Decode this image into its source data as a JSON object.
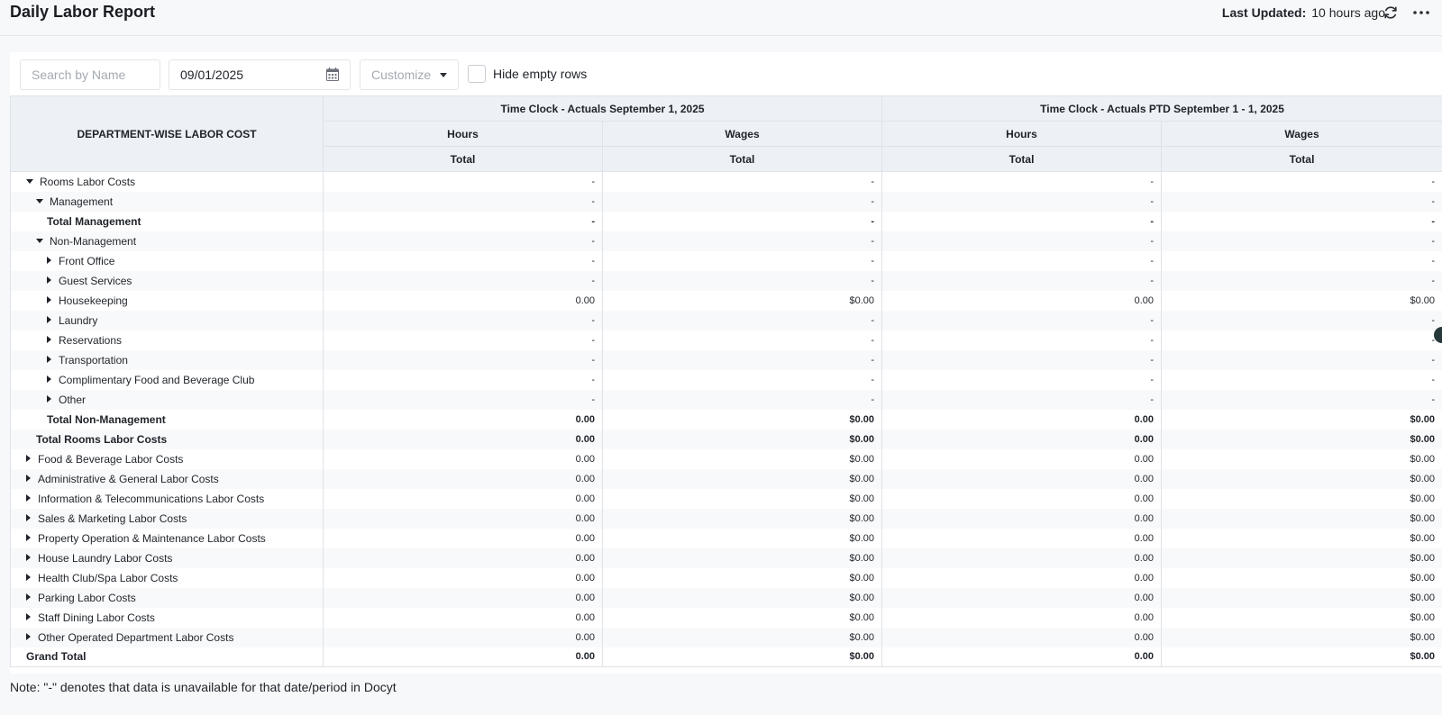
{
  "header": {
    "title": "Daily Labor Report",
    "last_updated_label": "Last Updated:",
    "last_updated_value": "10 hours ago"
  },
  "toolbar": {
    "search_placeholder": "Search by Name",
    "date_value": "09/01/2025",
    "customize_label": "Customize",
    "hide_empty_label": "Hide empty rows",
    "hide_empty_checked": false
  },
  "table": {
    "corner_header": "DEPARTMENT-WISE LABOR COST",
    "group_headers": [
      "Time Clock - Actuals September 1, 2025",
      "Time Clock - Actuals PTD September 1 - 1, 2025"
    ],
    "sub_headers": [
      "Hours",
      "Wages",
      "Hours",
      "Wages"
    ],
    "total_headers": [
      "Total",
      "Total",
      "Total",
      "Total"
    ],
    "rows": [
      {
        "label": "Rooms Labor Costs",
        "indent": 1,
        "toggle": "expanded",
        "bold": false,
        "values": [
          "-",
          "-",
          "-",
          "-"
        ]
      },
      {
        "label": "Management",
        "indent": 2,
        "toggle": "expanded",
        "bold": false,
        "values": [
          "-",
          "-",
          "-",
          "-"
        ]
      },
      {
        "label": "Total Management",
        "indent": 3,
        "toggle": "none",
        "bold": true,
        "values": [
          "-",
          "-",
          "-",
          "-"
        ]
      },
      {
        "label": "Non-Management",
        "indent": 2,
        "toggle": "expanded",
        "bold": false,
        "values": [
          "-",
          "-",
          "-",
          "-"
        ]
      },
      {
        "label": "Front Office",
        "indent": 3,
        "toggle": "collapsed",
        "bold": false,
        "values": [
          "-",
          "-",
          "-",
          "-"
        ]
      },
      {
        "label": "Guest Services",
        "indent": 3,
        "toggle": "collapsed",
        "bold": false,
        "values": [
          "-",
          "-",
          "-",
          "-"
        ]
      },
      {
        "label": "Housekeeping",
        "indent": 3,
        "toggle": "collapsed",
        "bold": false,
        "values": [
          "0.00",
          "$0.00",
          "0.00",
          "$0.00"
        ]
      },
      {
        "label": "Laundry",
        "indent": 3,
        "toggle": "collapsed",
        "bold": false,
        "values": [
          "-",
          "-",
          "-",
          "-"
        ]
      },
      {
        "label": "Reservations",
        "indent": 3,
        "toggle": "collapsed",
        "bold": false,
        "values": [
          "-",
          "-",
          "-",
          "-"
        ]
      },
      {
        "label": "Transportation",
        "indent": 3,
        "toggle": "collapsed",
        "bold": false,
        "values": [
          "-",
          "-",
          "-",
          "-"
        ]
      },
      {
        "label": "Complimentary Food and Beverage Club",
        "indent": 3,
        "toggle": "collapsed",
        "bold": false,
        "values": [
          "-",
          "-",
          "-",
          "-"
        ]
      },
      {
        "label": "Other",
        "indent": 3,
        "toggle": "collapsed",
        "bold": false,
        "values": [
          "-",
          "-",
          "-",
          "-"
        ]
      },
      {
        "label": "Total Non-Management",
        "indent": 3,
        "toggle": "none",
        "bold": true,
        "values": [
          "0.00",
          "$0.00",
          "0.00",
          "$0.00"
        ]
      },
      {
        "label": "Total Rooms Labor Costs",
        "indent": 2,
        "toggle": "none",
        "bold": true,
        "values": [
          "0.00",
          "$0.00",
          "0.00",
          "$0.00"
        ]
      },
      {
        "label": "Food & Beverage Labor Costs",
        "indent": 1,
        "toggle": "collapsed",
        "bold": false,
        "values": [
          "0.00",
          "$0.00",
          "0.00",
          "$0.00"
        ]
      },
      {
        "label": "Administrative & General Labor Costs",
        "indent": 1,
        "toggle": "collapsed",
        "bold": false,
        "values": [
          "0.00",
          "$0.00",
          "0.00",
          "$0.00"
        ]
      },
      {
        "label": "Information & Telecommunications Labor Costs",
        "indent": 1,
        "toggle": "collapsed",
        "bold": false,
        "values": [
          "0.00",
          "$0.00",
          "0.00",
          "$0.00"
        ]
      },
      {
        "label": "Sales & Marketing Labor Costs",
        "indent": 1,
        "toggle": "collapsed",
        "bold": false,
        "values": [
          "0.00",
          "$0.00",
          "0.00",
          "$0.00"
        ]
      },
      {
        "label": "Property Operation & Maintenance Labor Costs",
        "indent": 1,
        "toggle": "collapsed",
        "bold": false,
        "values": [
          "0.00",
          "$0.00",
          "0.00",
          "$0.00"
        ]
      },
      {
        "label": "House Laundry Labor Costs",
        "indent": 1,
        "toggle": "collapsed",
        "bold": false,
        "values": [
          "0.00",
          "$0.00",
          "0.00",
          "$0.00"
        ]
      },
      {
        "label": "Health Club/Spa Labor Costs",
        "indent": 1,
        "toggle": "collapsed",
        "bold": false,
        "values": [
          "0.00",
          "$0.00",
          "0.00",
          "$0.00"
        ]
      },
      {
        "label": "Parking Labor Costs",
        "indent": 1,
        "toggle": "collapsed",
        "bold": false,
        "values": [
          "0.00",
          "$0.00",
          "0.00",
          "$0.00"
        ]
      },
      {
        "label": "Staff Dining Labor Costs",
        "indent": 1,
        "toggle": "collapsed",
        "bold": false,
        "values": [
          "0.00",
          "$0.00",
          "0.00",
          "$0.00"
        ]
      },
      {
        "label": "Other Operated Department Labor Costs",
        "indent": 1,
        "toggle": "collapsed",
        "bold": false,
        "values": [
          "0.00",
          "$0.00",
          "0.00",
          "$0.00"
        ]
      },
      {
        "label": "Grand Total",
        "indent": 0,
        "toggle": "none",
        "bold": true,
        "values": [
          "0.00",
          "$0.00",
          "0.00",
          "$0.00"
        ]
      }
    ]
  },
  "footer": {
    "note": "Note: \"-\" denotes that data is unavailable for that date/period in Docyt"
  }
}
